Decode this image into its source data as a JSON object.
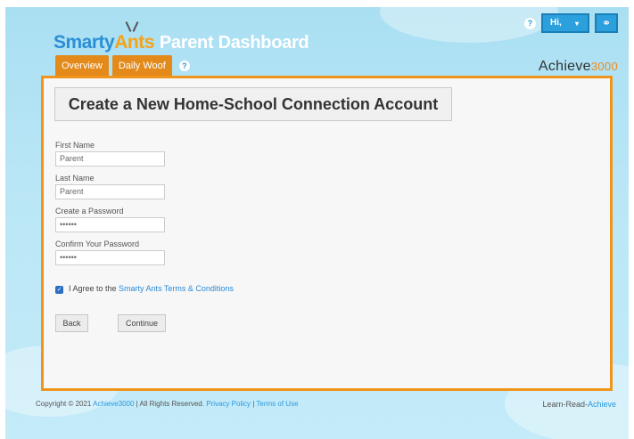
{
  "header": {
    "logo_smarty": "Smarty",
    "logo_ants": "Ants",
    "title": "Parent Dashboard",
    "tabs": [
      {
        "label": "Overview"
      },
      {
        "label": "Daily Woof"
      }
    ],
    "help_icon": "?",
    "achieve_logo_text": "Achieve",
    "achieve_logo_num": "3000",
    "user_greeting": "Hi,",
    "user_caret": "▾",
    "link_icon": "⚭"
  },
  "form": {
    "heading": "Create a New Home-School Connection Account",
    "first_name_label": "First Name",
    "first_name_value": "Parent",
    "last_name_label": "Last Name",
    "last_name_value": "Parent",
    "password_label": "Create a Password",
    "password_value": "••••••",
    "confirm_label": "Confirm Your Password",
    "confirm_value": "••••••",
    "agree_prefix": "I Agree to the ",
    "agree_link": "Smarty Ants Terms & Conditions",
    "checkbox_mark": "✓",
    "back_label": "Back",
    "continue_label": "Continue"
  },
  "footer": {
    "copyright_prefix": "Copyright © 2021 ",
    "copyright_link": "Achieve3000",
    "copyright_mid": " | All Rights Reserved. ",
    "privacy_link": "Privacy Policy",
    "separator": " | ",
    "terms_link": "Terms of Use",
    "tagline_prefix": "Learn-Read-",
    "tagline_link": "Achieve"
  },
  "colors": {
    "panel_border": "#f0941c",
    "tab_bg": "#e38a1a",
    "link": "#2a8ad6",
    "background": "#b9e6f6"
  }
}
